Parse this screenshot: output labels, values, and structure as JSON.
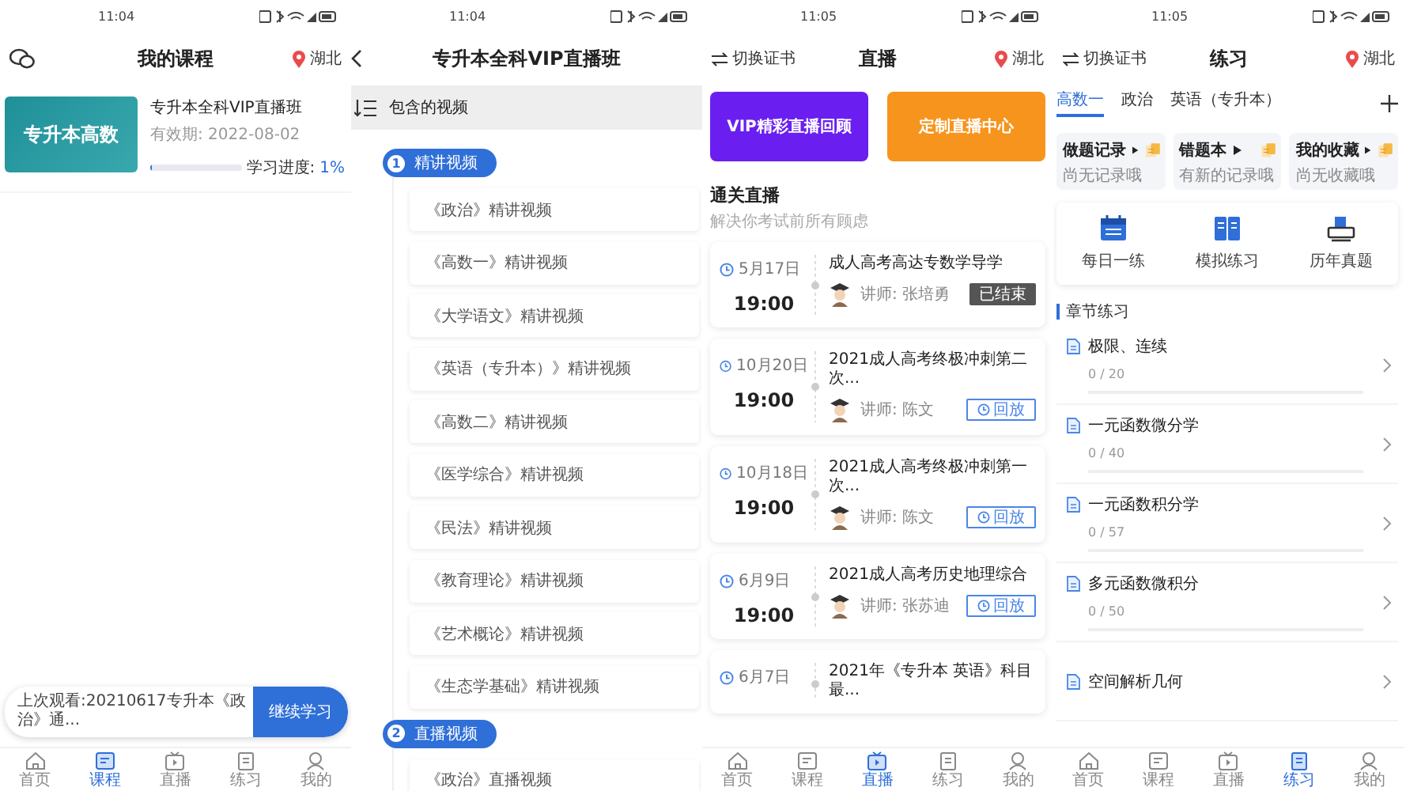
{
  "screens": [
    {
      "kind": "my-courses",
      "status_time": "11:04",
      "header": {
        "title": "我的课程",
        "location": "湖北"
      },
      "courses": [
        {
          "thumb_title": "专升本高数",
          "name": "专升本全科VIP直播班",
          "validity": "有效期:  2022-08-02",
          "progress_label": "学习进度:",
          "progress_value": "1%",
          "level": 0.01
        }
      ],
      "resume": {
        "text": "上次观看:20210617专升本《政治》通...",
        "button": "继续学习"
      },
      "nav": [
        {
          "label": "首页",
          "kind": "home",
          "selected": false
        },
        {
          "label": "课程",
          "kind": "course",
          "selected": true
        },
        {
          "label": "直播",
          "kind": "live",
          "selected": false
        },
        {
          "label": "练习",
          "kind": "practice",
          "selected": false
        },
        {
          "label": "我的",
          "kind": "mine",
          "selected": false
        }
      ]
    },
    {
      "kind": "course-detail",
      "status_time": "11:04",
      "title": "专升本全科VIP直播班",
      "section_header": "包含的视频",
      "groups": [
        {
          "number": "1",
          "title": "精讲视频",
          "items": [
            "《政治》精讲视频",
            "《高数一》精讲视频",
            "《大学语文》精讲视频",
            "《英语（专升本）》精讲视频",
            "《高数二》精讲视频",
            "《医学综合》精讲视频",
            "《民法》精讲视频",
            "《教育理论》精讲视频",
            "《艺术概论》精讲视频",
            "《生态学基础》精讲视频"
          ]
        },
        {
          "number": "2",
          "title": "直播视频",
          "items": [
            "《政治》直播视频"
          ]
        }
      ]
    },
    {
      "kind": "live",
      "status_time": "11:05",
      "header": {
        "switch": "切换证书",
        "title": "直播",
        "location": "湖北"
      },
      "banners": [
        {
          "text": "VIP精彩直播回顾",
          "color": "#6a1ff0"
        },
        {
          "text": "定制直播中心",
          "color": "#f7941d"
        }
      ],
      "section_title": "通关直播",
      "section_subtitle": "解决你考试前所有顾虑",
      "sessions": [
        {
          "date": "5月17日",
          "time": "19:00",
          "title": "成人高考高达专数学导学",
          "teacher": "讲师: 张培勇",
          "status": "已结束",
          "kind": "ended"
        },
        {
          "date": "10月20日",
          "time": "19:00",
          "title": "2021成人高考终极冲刺第二次...",
          "teacher": "讲师: 陈文",
          "status": "回放",
          "kind": "replay"
        },
        {
          "date": "10月18日",
          "time": "19:00",
          "title": "2021成人高考终极冲刺第一次...",
          "teacher": "讲师: 陈文",
          "status": "回放",
          "kind": "replay"
        },
        {
          "date": "6月9日",
          "time": "19:00",
          "title": "2021成人高考历史地理综合",
          "teacher": "讲师: 张苏迪",
          "status": "回放",
          "kind": "replay"
        },
        {
          "date": "6月7日",
          "title": "2021年《专升本 英语》科目最..."
        }
      ],
      "nav": [
        {
          "label": "首页",
          "kind": "home",
          "selected": false
        },
        {
          "label": "课程",
          "kind": "course",
          "selected": false
        },
        {
          "label": "直播",
          "kind": "live",
          "selected": true
        },
        {
          "label": "练习",
          "kind": "practice",
          "selected": false
        },
        {
          "label": "我的",
          "kind": "mine",
          "selected": false
        }
      ]
    },
    {
      "kind": "practice",
      "status_time": "11:05",
      "header": {
        "switch": "切换证书",
        "title": "练习",
        "location": "湖北"
      },
      "subjects": [
        {
          "label": "高数一",
          "selected": true
        },
        {
          "label": "政治",
          "selected": false
        },
        {
          "label": "英语（专升本）",
          "selected": false
        }
      ],
      "shortcuts": [
        {
          "title": "做题记录",
          "subtitle": "尚无记录哦"
        },
        {
          "title": "错题本",
          "subtitle": "有新的记录哦"
        },
        {
          "title": "我的收藏",
          "subtitle": "尚无收藏哦"
        }
      ],
      "tools": [
        {
          "label": "每日一练",
          "kind": "calendar"
        },
        {
          "label": "模拟练习",
          "kind": "book"
        },
        {
          "label": "历年真题",
          "kind": "printer"
        }
      ],
      "chapter_title": "章节练习",
      "chapters": [
        {
          "title": "极限、连续",
          "count": "0 / 20",
          "level": 0
        },
        {
          "title": "一元函数微分学",
          "count": "0 / 40",
          "level": 0
        },
        {
          "title": "一元函数积分学",
          "count": "0 / 57",
          "level": 0
        },
        {
          "title": "多元函数微积分",
          "count": "0 / 50",
          "level": 0
        },
        {
          "title": "空间解析几何"
        }
      ],
      "nav": [
        {
          "label": "首页",
          "kind": "home",
          "selected": false
        },
        {
          "label": "课程",
          "kind": "course",
          "selected": false
        },
        {
          "label": "直播",
          "kind": "live",
          "selected": false
        },
        {
          "label": "练习",
          "kind": "practice",
          "selected": true
        },
        {
          "label": "我的",
          "kind": "mine",
          "selected": false
        }
      ]
    }
  ]
}
